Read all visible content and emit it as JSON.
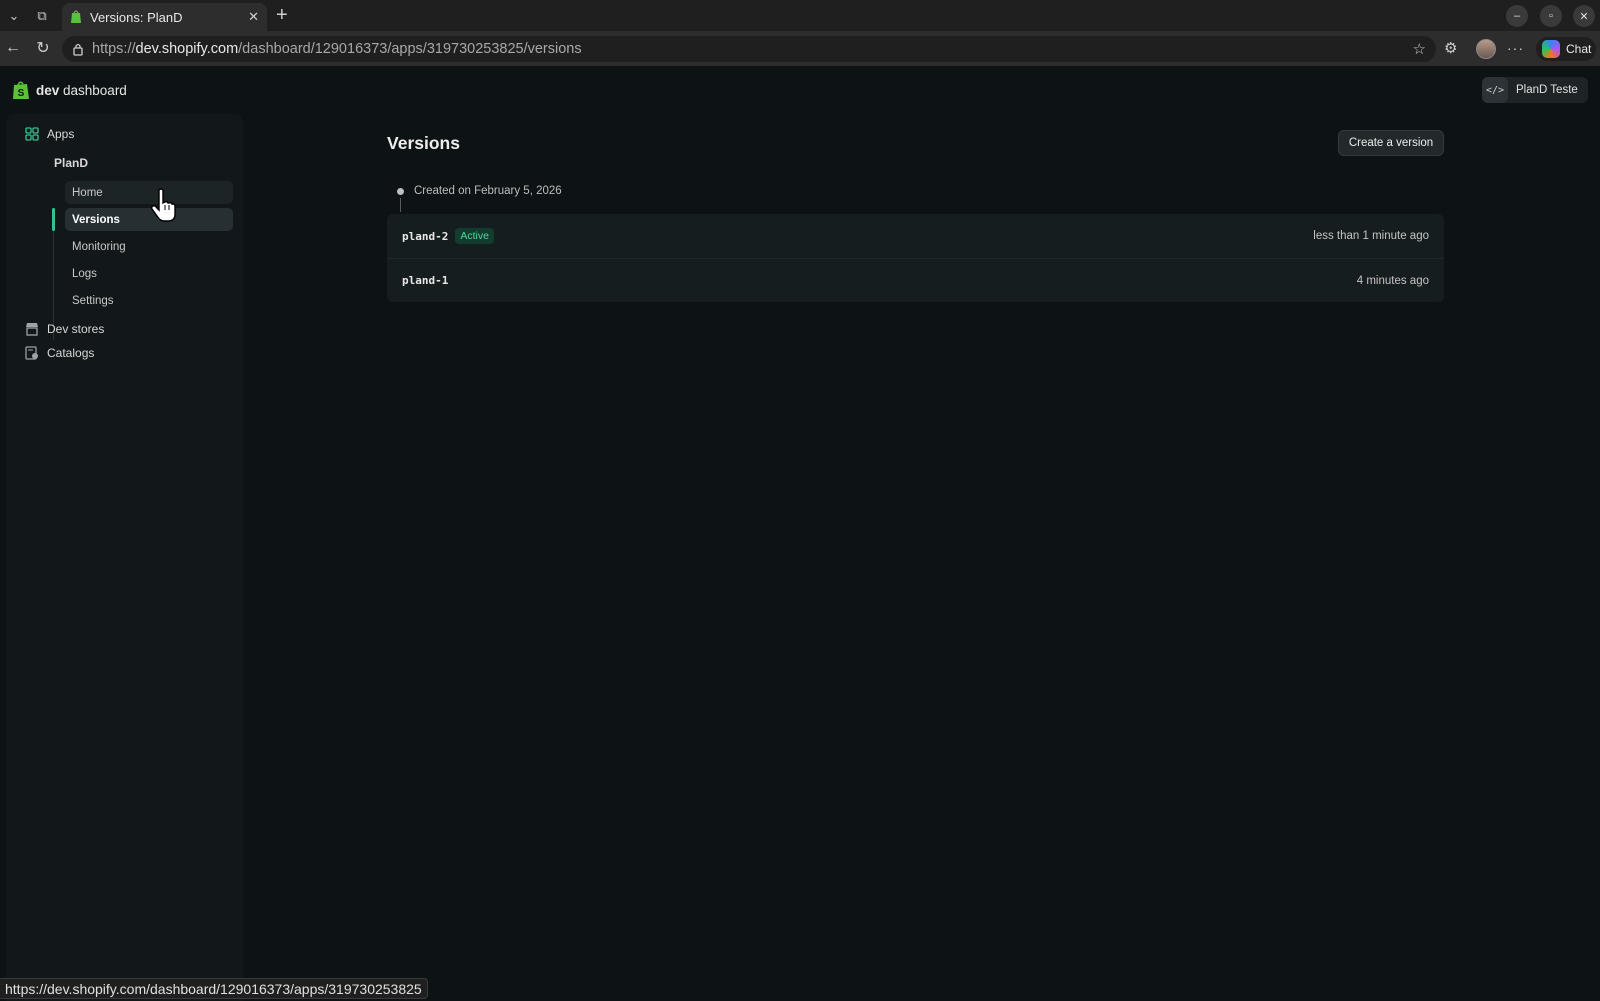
{
  "browser": {
    "tab_title": "Versions: PlanD",
    "url_scheme": "https://",
    "url_host": "dev.shopify.com",
    "url_path": "/dashboard/129016373/apps/319730253825/versions",
    "chat_label": "Chat",
    "status_url": "https://dev.shopify.com/dashboard/129016373/apps/319730253825"
  },
  "header": {
    "logo_bold": "dev",
    "logo_rest": " dashboard",
    "org_name": "PlanD Teste"
  },
  "sidebar": {
    "apps_label": "Apps",
    "app_name": "PlanD",
    "items": [
      {
        "label": "Home"
      },
      {
        "label": "Versions"
      },
      {
        "label": "Monitoring"
      },
      {
        "label": "Logs"
      },
      {
        "label": "Settings"
      }
    ],
    "dev_stores_label": "Dev stores",
    "catalogs_label": "Catalogs"
  },
  "main": {
    "title": "Versions",
    "create_button": "Create a version",
    "created_on": "Created on February 5, 2026",
    "versions": [
      {
        "name": "pland-2",
        "badge": "Active",
        "time": "less than 1 minute ago"
      },
      {
        "name": "pland-1",
        "time": "4 minutes ago"
      }
    ]
  },
  "colors": {
    "accent": "#36c28f",
    "badge_bg": "#123c2d",
    "badge_text": "#52d69f",
    "background": "#0d1214"
  }
}
